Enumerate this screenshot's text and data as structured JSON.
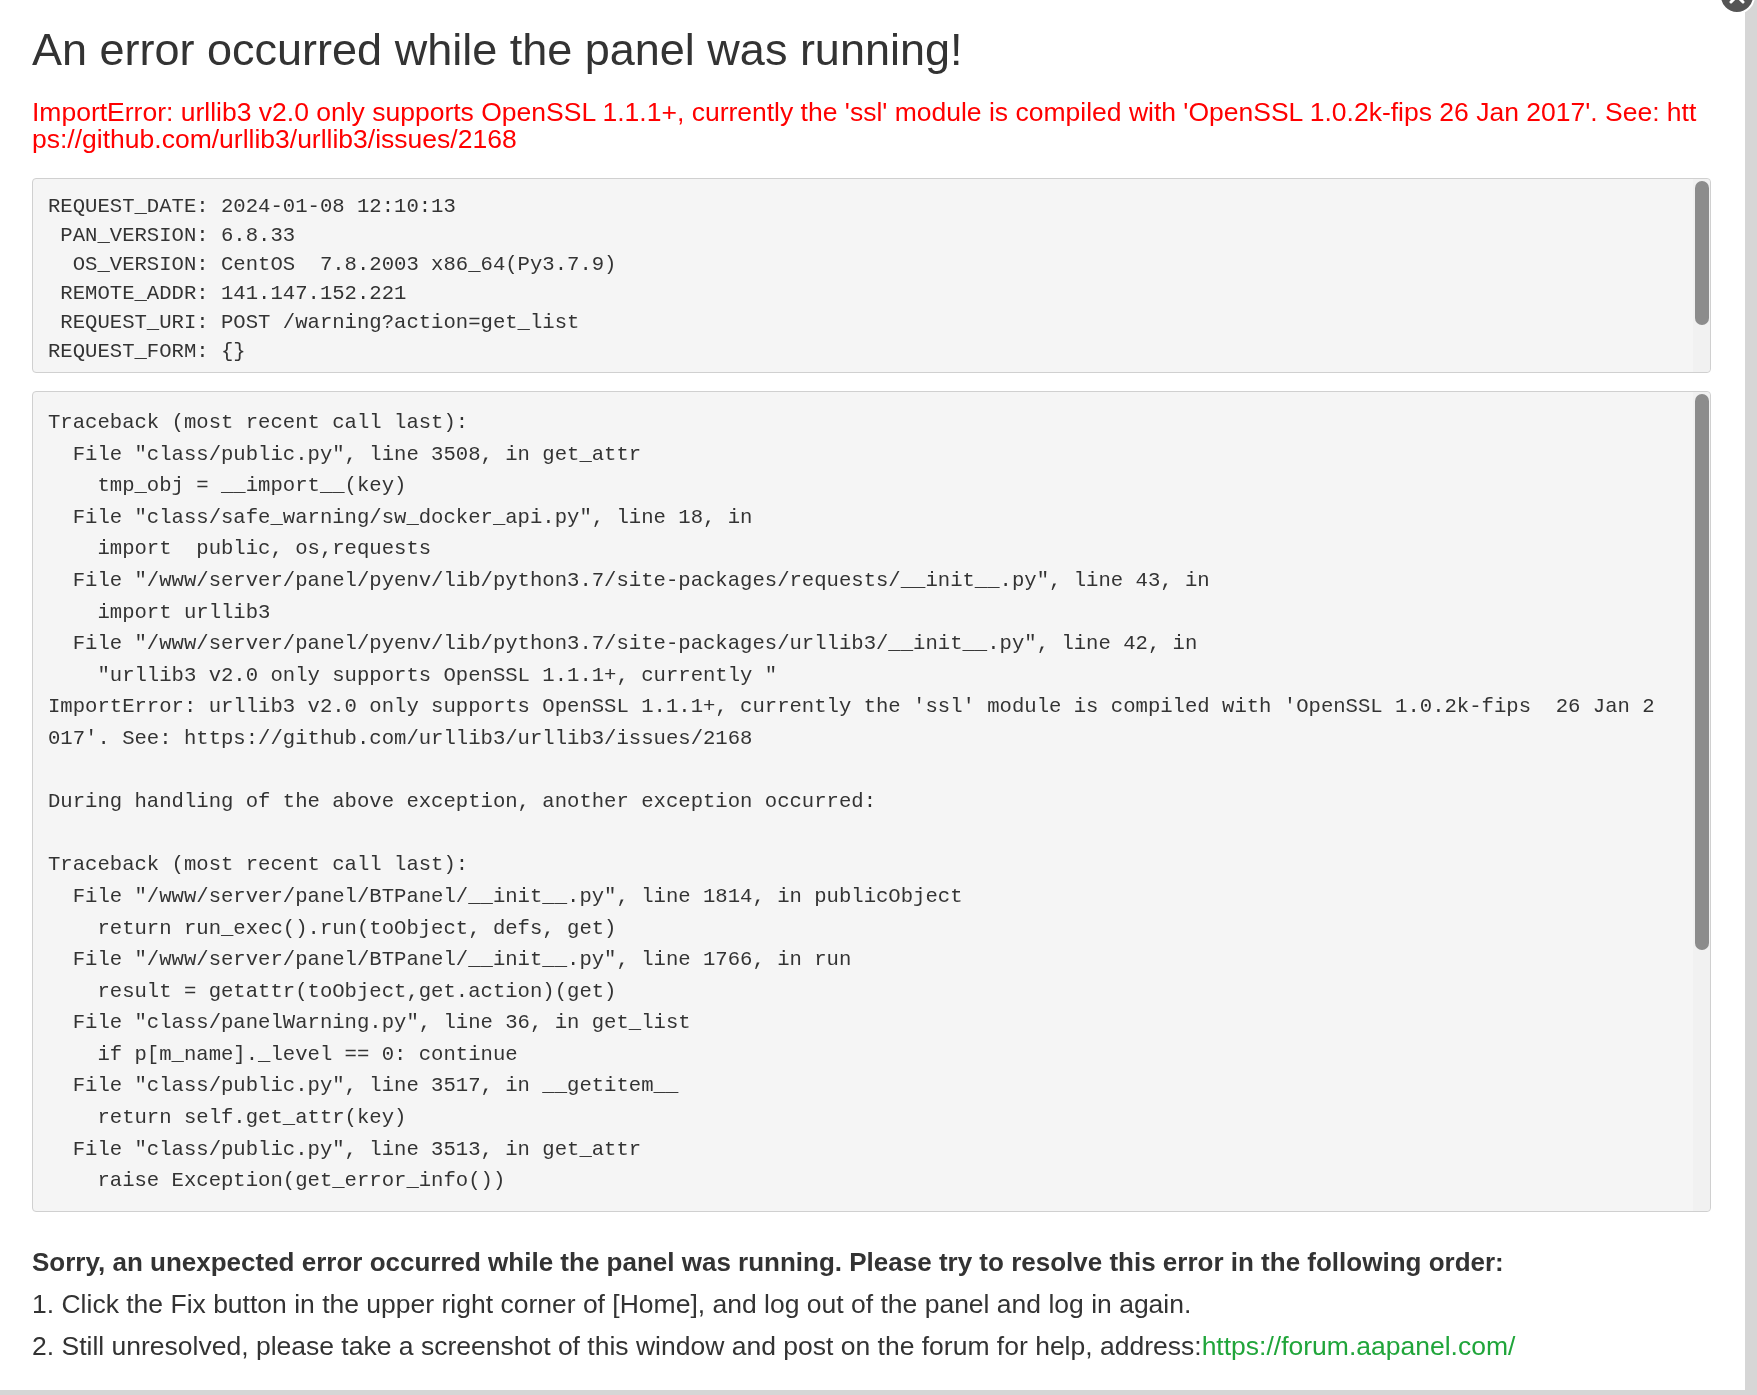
{
  "dialog": {
    "title": "An error occurred while the panel was running!",
    "error_message": "ImportError: urllib3 v2.0 only supports OpenSSL 1.1.1+, currently the 'ssl' module is compiled with 'OpenSSL 1.0.2k-fips 26 Jan 2017'. See: https://github.com/urllib3/urllib3/issues/2168",
    "request_info": {
      "lines": [
        "REQUEST_DATE: 2024-01-08 12:10:13",
        " PAN_VERSION: 6.8.33",
        "  OS_VERSION: CentOS  7.8.2003 x86_64(Py3.7.9)",
        " REMOTE_ADDR: 141.147.152.221",
        " REQUEST_URI: POST /warning?action=get_list",
        "REQUEST_FORM: {}"
      ]
    },
    "traceback": {
      "blocks": [
        [
          "Traceback (most recent call last):",
          "  File \"class/public.py\", line 3508, in get_attr",
          "    tmp_obj = __import__(key)",
          "  File \"class/safe_warning/sw_docker_api.py\", line 18, in",
          "    import  public, os,requests",
          "  File \"/www/server/panel/pyenv/lib/python3.7/site-packages/requests/__init__.py\", line 43, in",
          "    import urllib3",
          "  File \"/www/server/panel/pyenv/lib/python3.7/site-packages/urllib3/__init__.py\", line 42, in",
          "    \"urllib3 v2.0 only supports OpenSSL 1.1.1+, currently \"",
          "ImportError: urllib3 v2.0 only supports OpenSSL 1.1.1+, currently the 'ssl' module is compiled with 'OpenSSL 1.0.2k-fips  26 Jan 2",
          "017'. See: https://github.com/urllib3/urllib3/issues/2168"
        ],
        [
          "During handling of the above exception, another exception occurred:"
        ],
        [
          "Traceback (most recent call last):",
          "  File \"/www/server/panel/BTPanel/__init__.py\", line 1814, in publicObject",
          "    return run_exec().run(toObject, defs, get)",
          "  File \"/www/server/panel/BTPanel/__init__.py\", line 1766, in run",
          "    result = getattr(toObject,get.action)(get)",
          "  File \"class/panelWarning.py\", line 36, in get_list",
          "    if p[m_name]._level == 0: continue",
          "  File \"class/public.py\", line 3517, in __getitem__",
          "    return self.get_attr(key)",
          "  File \"class/public.py\", line 3513, in get_attr",
          "    raise Exception(get_error_info())"
        ]
      ]
    },
    "help": {
      "heading": "Sorry, an unexpected error occurred while the panel was running. Please try to resolve this error in the following order:",
      "steps": [
        {
          "text": "1. Click the Fix button in the upper right corner of [Home], and log out of the panel and log in again."
        },
        {
          "text": "2. Still unresolved, please take a screenshot of this window and post on the forum for help, address:",
          "link": "https://forum.aapanel.com/"
        }
      ]
    }
  }
}
